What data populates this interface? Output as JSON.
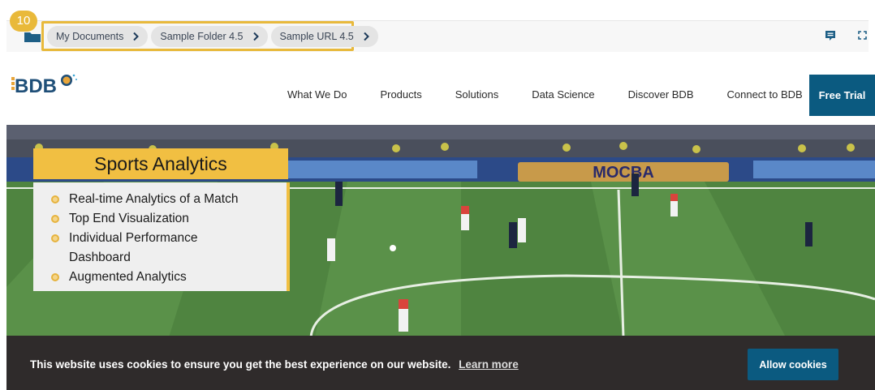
{
  "step": {
    "number": "10"
  },
  "breadcrumb": {
    "items": [
      {
        "label": "My Documents"
      },
      {
        "label": "Sample Folder 4.5"
      },
      {
        "label": "Sample URL 4.5"
      }
    ]
  },
  "icons": {
    "folder": "folder-icon",
    "chevron": "chevron-right-icon",
    "comment": "comment-icon",
    "fullscreen": "expand-icon"
  },
  "nav": {
    "logo_alt": "BDB AI",
    "links": [
      "What We Do",
      "Products",
      "Solutions",
      "Data Science",
      "Discover BDB",
      "Connect to BDB"
    ],
    "cta": "Free Trial"
  },
  "hero": {
    "title": "Sports Analytics",
    "bullets": [
      "Real-time Analytics of a Match",
      "Top End Visualization",
      "Individual Performance Dashboard",
      "Augmented Analytics"
    ],
    "banner_text": "MOCBA"
  },
  "cookie": {
    "message": "This website uses cookies to ensure you get the best experience on our website.",
    "link": "Learn more",
    "button": "Allow cookies"
  },
  "colors": {
    "accent_yellow": "#f1bf42",
    "brand_blue": "#0b5a80",
    "cookie_bg": "#2f2b2b"
  }
}
